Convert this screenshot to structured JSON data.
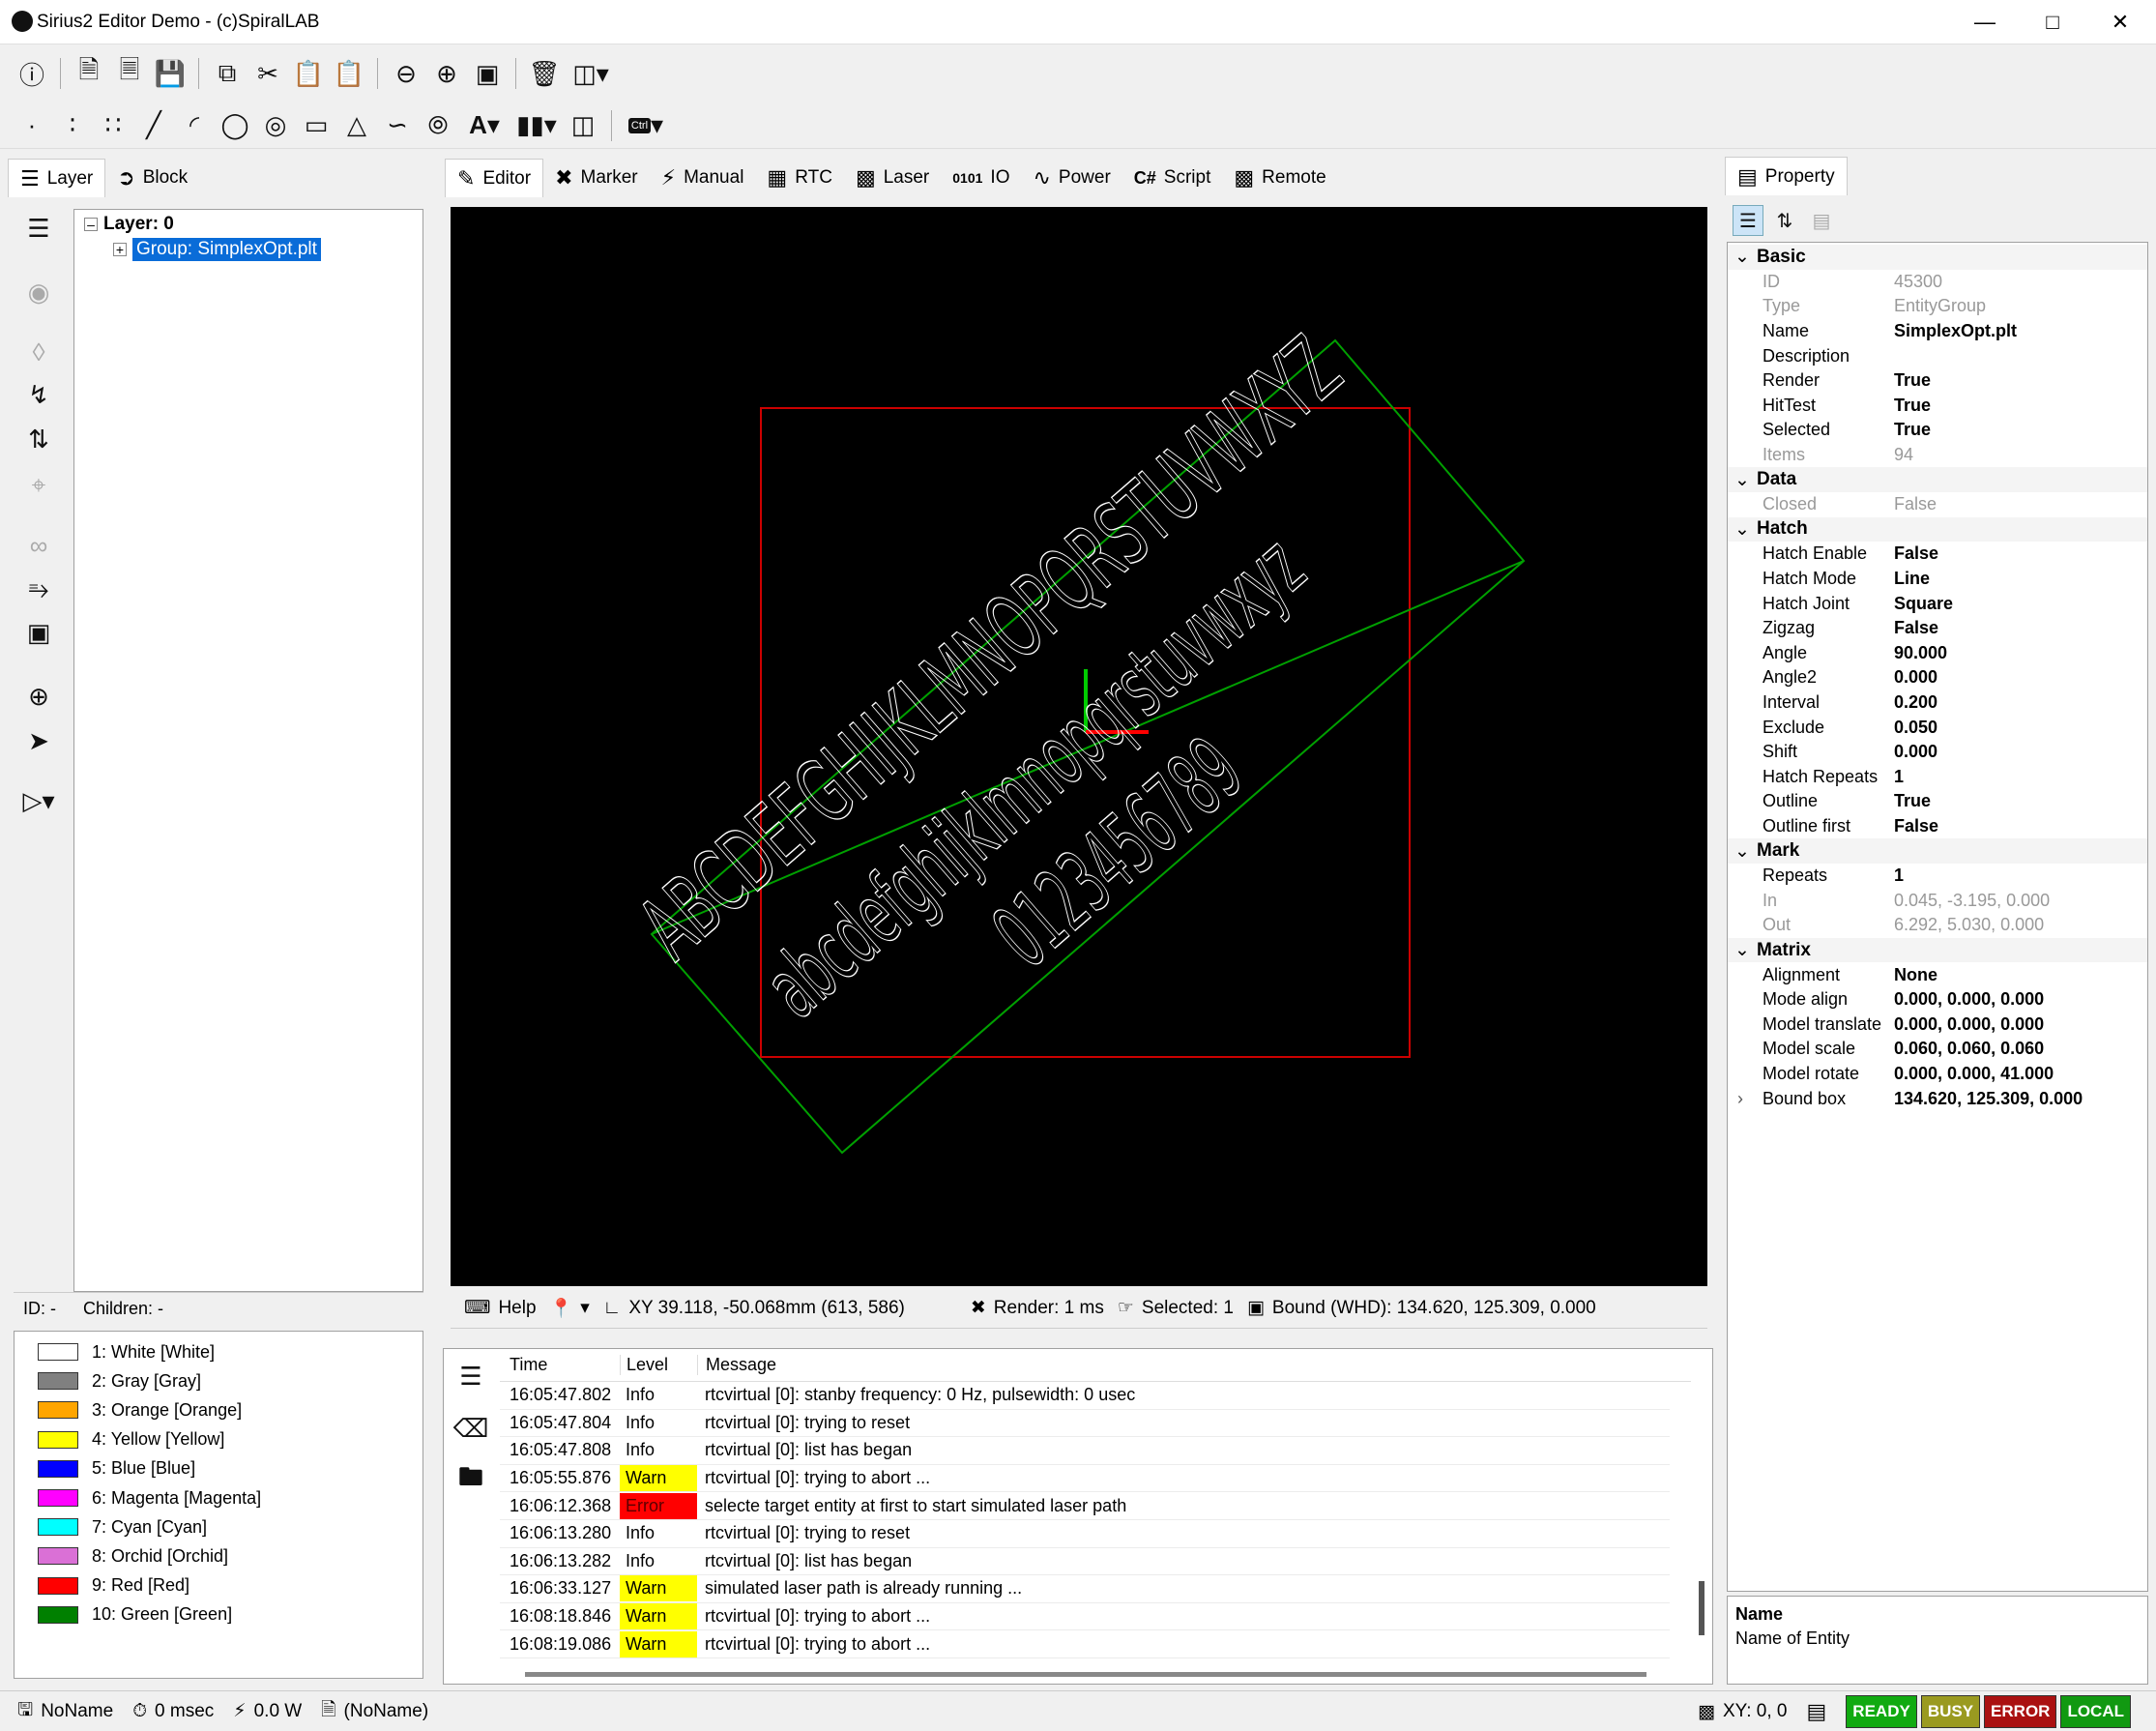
{
  "window": {
    "title": "Sirius2 Editor Demo - (c)SpiralLAB"
  },
  "left_tabs": [
    "Layer",
    "Block"
  ],
  "tree": {
    "layer": "Layer: 0",
    "group": "Group: SimplexOpt.plt"
  },
  "tree_footer": {
    "id": "ID: -",
    "children": "Children: -"
  },
  "pens": [
    {
      "label": "1: White [White]",
      "color": "#ffffff"
    },
    {
      "label": "2: Gray [Gray]",
      "color": "#808080"
    },
    {
      "label": "3: Orange [Orange]",
      "color": "#ffa500"
    },
    {
      "label": "4: Yellow [Yellow]",
      "color": "#ffff00"
    },
    {
      "label": "5: Blue [Blue]",
      "color": "#0000ff"
    },
    {
      "label": "6: Magenta [Magenta]",
      "color": "#ff00ff"
    },
    {
      "label": "7: Cyan [Cyan]",
      "color": "#00ffff"
    },
    {
      "label": "8: Orchid [Orchid]",
      "color": "#da70d6"
    },
    {
      "label": "9: Red [Red]",
      "color": "#ff0000"
    },
    {
      "label": "10: Green [Green]",
      "color": "#008000"
    }
  ],
  "center_tabs": [
    "Editor",
    "Marker",
    "Manual",
    "RTC",
    "Laser",
    "IO",
    "Power",
    "Script",
    "Remote"
  ],
  "canvas": {
    "text_upper": "ABCDEFGHIJKLMNOPQRSTUVWXYZ",
    "text_lower": "abcdefghijklmnopqrstuvwxyz",
    "text_digits": "0123456789",
    "colors": {
      "background": "#000000",
      "bound": "#cc0000",
      "rotated_box": "#00a000",
      "text": "#ffffff"
    }
  },
  "canvas_status": {
    "help": "Help",
    "xy": "XY 39.118, -50.068mm (613, 586)",
    "render": "Render: 1 ms",
    "selected": "Selected: 1",
    "bound": "Bound (WHD): 134.620, 125.309, 0.000"
  },
  "log": {
    "headers": {
      "time": "Time",
      "level": "Level",
      "message": "Message"
    },
    "rows": [
      {
        "time": "16:05:47.802",
        "level": "Info",
        "message": "rtcvirtual [0]: stanby frequency: 0 Hz, pulsewidth: 0 usec"
      },
      {
        "time": "16:05:47.804",
        "level": "Info",
        "message": "rtcvirtual [0]: trying to reset"
      },
      {
        "time": "16:05:47.808",
        "level": "Info",
        "message": "rtcvirtual [0]: list has began"
      },
      {
        "time": "16:05:55.876",
        "level": "Warn",
        "message": "rtcvirtual [0]: trying to abort ..."
      },
      {
        "time": "16:06:12.368",
        "level": "Error",
        "message": "selecte target entity at first to start simulated laser path"
      },
      {
        "time": "16:06:13.280",
        "level": "Info",
        "message": "rtcvirtual [0]: trying to reset"
      },
      {
        "time": "16:06:13.282",
        "level": "Info",
        "message": "rtcvirtual [0]: list has began"
      },
      {
        "time": "16:06:33.127",
        "level": "Warn",
        "message": "simulated laser path is already running ..."
      },
      {
        "time": "16:08:18.846",
        "level": "Warn",
        "message": "rtcvirtual [0]: trying to abort ..."
      },
      {
        "time": "16:08:19.086",
        "level": "Warn",
        "message": "rtcvirtual [0]: trying to abort ..."
      }
    ]
  },
  "property": {
    "tab": "Property",
    "sections": [
      {
        "name": "Basic",
        "rows": [
          {
            "k": "ID",
            "v": "45300",
            "ro": true
          },
          {
            "k": "Type",
            "v": "EntityGroup",
            "ro": true
          },
          {
            "k": "Name",
            "v": "SimplexOpt.plt"
          },
          {
            "k": "Description",
            "v": ""
          },
          {
            "k": "Render",
            "v": "True"
          },
          {
            "k": "HitTest",
            "v": "True"
          },
          {
            "k": "Selected",
            "v": "True"
          },
          {
            "k": "Items",
            "v": "94",
            "ro": true
          }
        ]
      },
      {
        "name": "Data",
        "rows": [
          {
            "k": "Closed",
            "v": "False",
            "ro": true
          }
        ]
      },
      {
        "name": "Hatch",
        "rows": [
          {
            "k": "Hatch Enable",
            "v": "False"
          },
          {
            "k": "Hatch Mode",
            "v": "Line"
          },
          {
            "k": "Hatch Joint",
            "v": "Square"
          },
          {
            "k": "Zigzag",
            "v": "False"
          },
          {
            "k": "Angle",
            "v": "90.000"
          },
          {
            "k": "Angle2",
            "v": "0.000"
          },
          {
            "k": "Interval",
            "v": "0.200"
          },
          {
            "k": "Exclude",
            "v": "0.050"
          },
          {
            "k": "Shift",
            "v": "0.000"
          },
          {
            "k": "Hatch Repeats",
            "v": "1"
          },
          {
            "k": "Outline",
            "v": "True"
          },
          {
            "k": "Outline first",
            "v": "False"
          }
        ]
      },
      {
        "name": "Mark",
        "rows": [
          {
            "k": "Repeats",
            "v": "1"
          },
          {
            "k": "In",
            "v": "0.045, -3.195, 0.000",
            "ro": true
          },
          {
            "k": "Out",
            "v": "6.292, 5.030, 0.000",
            "ro": true
          }
        ]
      },
      {
        "name": "Matrix",
        "rows": [
          {
            "k": "Alignment",
            "v": "None"
          },
          {
            "k": "Mode align",
            "v": "0.000, 0.000, 0.000"
          },
          {
            "k": "Model translate",
            "v": "0.000, 0.000, 0.000"
          },
          {
            "k": "Model scale",
            "v": "0.060, 0.060, 0.060"
          },
          {
            "k": "Model rotate",
            "v": "0.000, 0.000, 41.000"
          },
          {
            "k": "Bound box",
            "v": "134.620, 125.309, 0.000",
            "expandable": true
          }
        ]
      }
    ],
    "desc_title": "Name",
    "desc_text": "Name of Entity"
  },
  "statusbar": {
    "name": "NoName",
    "time": "0 msec",
    "power": "0.0 W",
    "doc": "(NoName)",
    "xy": "XY: 0, 0",
    "badges": [
      {
        "label": "READY",
        "color": "#11aa11"
      },
      {
        "label": "BUSY",
        "color": "#9a9a20"
      },
      {
        "label": "ERROR",
        "color": "#aa1111"
      },
      {
        "label": "LOCAL",
        "color": "#119911"
      }
    ]
  }
}
